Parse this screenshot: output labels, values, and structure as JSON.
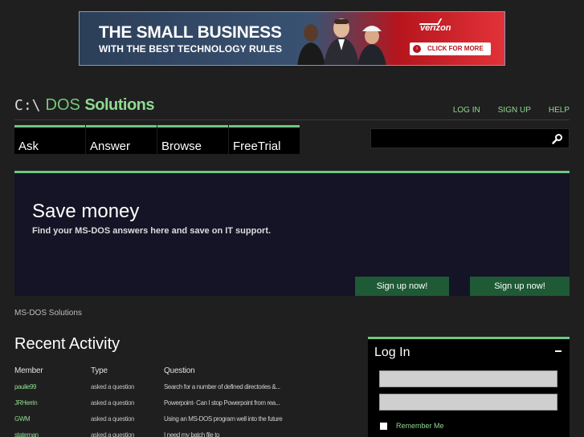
{
  "banner": {
    "line1": "THE SMALL BUSINESS",
    "line2": "WITH THE BEST TECHNOLOGY RULES",
    "brand": "verizon",
    "cta": "CLICK FOR MORE"
  },
  "header": {
    "logo_prompt": "C:\\",
    "logo_word1": "DOS",
    "logo_word2": "Solutions",
    "links": [
      "LOG IN",
      "SIGN UP",
      "HELP"
    ]
  },
  "nav": {
    "tabs": [
      "Ask",
      "Answer",
      "Browse",
      "FreeTrial"
    ]
  },
  "search": {
    "value": "",
    "placeholder": ""
  },
  "hero": {
    "title": "Save money",
    "subtitle": "Find your MS-DOS answers here and save on IT support.",
    "button1": "Sign up now!",
    "button2": "Sign up now!"
  },
  "breadcrumb": "MS-DOS Solutions",
  "recent": {
    "title": "Recent Activity",
    "headers": [
      "Member",
      "Type",
      "Question"
    ],
    "rows": [
      {
        "member": "paulie99",
        "type": "asked a question",
        "question": "Search for a number of defined directories &..."
      },
      {
        "member": "JRHerrin",
        "type": "asked a question",
        "question": "Powerpoint- Can I stop Powerpoint from rea..."
      },
      {
        "member": "GWM",
        "type": "asked a question",
        "question": "Using an MS-DOS program well into the future"
      },
      {
        "member": "stateman",
        "type": "asked a question",
        "question": "I need my batch file to"
      }
    ]
  },
  "login": {
    "title": "Log In",
    "remember": "Remember Me"
  },
  "colors": {
    "accent": "#6fc781",
    "link": "#8fd990",
    "hero_bg": "#151426",
    "button": "#1e5a35"
  }
}
